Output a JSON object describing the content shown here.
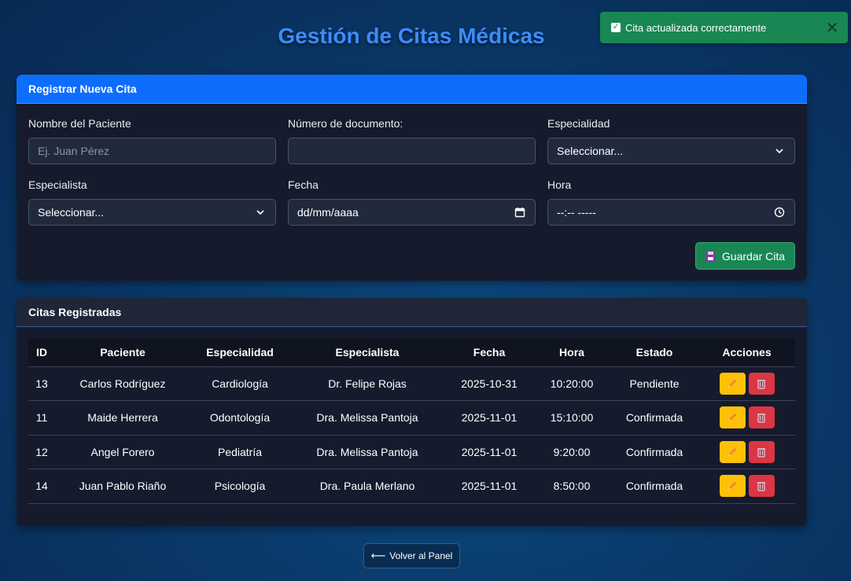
{
  "page": {
    "title": "Gestión de Citas Médicas"
  },
  "toast": {
    "message": "Cita actualizada correctamente",
    "close_symbol": "✕"
  },
  "form": {
    "header": "Registrar Nueva Cita",
    "patient_name": {
      "label": "Nombre del Paciente",
      "placeholder": "Ej. Juan Pérez"
    },
    "document_number": {
      "label": "Número de documento:",
      "value": ""
    },
    "specialty": {
      "label": "Especialidad",
      "selected": "Seleccionar..."
    },
    "specialist": {
      "label": "Especialista",
      "selected": "Seleccionar..."
    },
    "date": {
      "label": "Fecha",
      "placeholder": "dd/mm/aaaa"
    },
    "time": {
      "label": "Hora",
      "placeholder": "--:-- -----"
    },
    "save_label": "Guardar Cita"
  },
  "list": {
    "header": "Citas Registradas",
    "columns": [
      "ID",
      "Paciente",
      "Especialidad",
      "Especialista",
      "Fecha",
      "Hora",
      "Estado",
      "Acciones"
    ],
    "rows": [
      {
        "id": "13",
        "patient": "Carlos Rodríguez",
        "specialty": "Cardiología",
        "specialist": "Dr. Felipe Rojas",
        "date": "2025-10-31",
        "time": "10:20:00",
        "status": "Pendiente"
      },
      {
        "id": "11",
        "patient": "Maide Herrera",
        "specialty": "Odontología",
        "specialist": "Dra. Melissa Pantoja",
        "date": "2025-11-01",
        "time": "15:10:00",
        "status": "Confirmada"
      },
      {
        "id": "12",
        "patient": "Angel Forero",
        "specialty": "Pediatría",
        "specialist": "Dra. Melissa Pantoja",
        "date": "2025-11-01",
        "time": "9:20:00",
        "status": "Confirmada"
      },
      {
        "id": "14",
        "patient": "Juan Pablo Riaño",
        "specialty": "Psicología",
        "specialist": "Dra. Paula Merlano",
        "date": "2025-11-01",
        "time": "8:50:00",
        "status": "Confirmada"
      }
    ]
  },
  "back_button": {
    "label": "Volver al Panel",
    "arrow": "⟵"
  },
  "icons": {
    "toast": "check-square-icon",
    "close": "close-icon",
    "save": "floppy-disk-icon",
    "edit": "pencil-icon",
    "delete": "wastebasket-icon",
    "back": "left-arrow-icon",
    "select": "chevron-down-icon",
    "date": "calendar-icon",
    "time": "clock-icon"
  },
  "colors": {
    "title": "#3d8bfd",
    "form_header": "#0d6efd",
    "success": "#198754",
    "edit": "#ffc107",
    "delete": "#dc3545"
  }
}
